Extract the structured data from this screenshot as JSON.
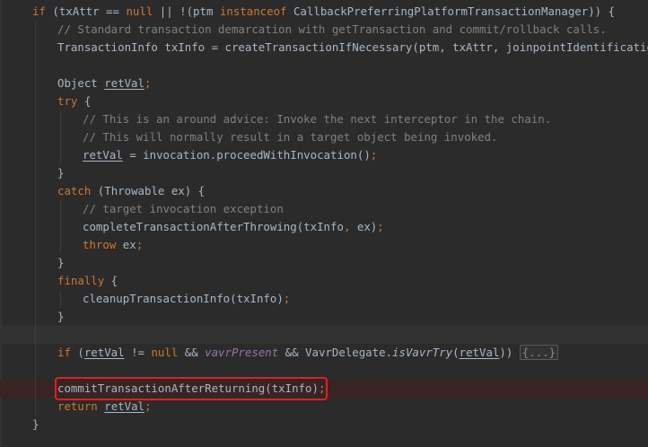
{
  "editor": {
    "colors": {
      "background": "#2b2b2b",
      "default": "#a9b7c6",
      "keyword": "#cc7832",
      "comment": "#808080",
      "field": "#9876aa",
      "highlight_box": "#e0201f"
    },
    "lines": [
      {
        "indent": 1,
        "tokens": [
          {
            "t": "if",
            "c": "kw"
          },
          {
            "t": " (txAttr == "
          },
          {
            "t": "null",
            "c": "kw"
          },
          {
            "t": " || !(ptm "
          },
          {
            "t": "instanceof",
            "c": "kw"
          },
          {
            "t": " CallbackPreferringPlatformTransactionManager)) {"
          }
        ]
      },
      {
        "indent": 2,
        "tokens": [
          {
            "t": "// Standard transaction demarcation with getTransaction and commit/rollback calls.",
            "c": "cm"
          }
        ]
      },
      {
        "indent": 2,
        "tokens": [
          {
            "t": "TransactionInfo txInfo = createTransactionIfNecessary(ptm, txAttr, joinpointIdentification)"
          },
          {
            "t": ";",
            "c": "kw"
          }
        ]
      },
      {
        "indent": 0,
        "tokens": []
      },
      {
        "indent": 2,
        "tokens": [
          {
            "t": "Object "
          },
          {
            "t": "retVal",
            "c": "ul"
          },
          {
            "t": ";",
            "c": "kw"
          }
        ]
      },
      {
        "indent": 2,
        "tokens": [
          {
            "t": "try",
            "c": "kw"
          },
          {
            "t": " {"
          }
        ]
      },
      {
        "indent": 3,
        "tokens": [
          {
            "t": "// This is an around advice: Invoke the next interceptor in the chain.",
            "c": "cm"
          }
        ]
      },
      {
        "indent": 3,
        "tokens": [
          {
            "t": "// This will normally result in a target object being invoked.",
            "c": "cm"
          }
        ]
      },
      {
        "indent": 3,
        "tokens": [
          {
            "t": "retVal",
            "c": "ul"
          },
          {
            "t": " = invocation.proceedWithInvocation()"
          },
          {
            "t": ";",
            "c": "kw"
          }
        ]
      },
      {
        "indent": 2,
        "tokens": [
          {
            "t": "}"
          }
        ]
      },
      {
        "indent": 2,
        "tokens": [
          {
            "t": "catch",
            "c": "kw"
          },
          {
            "t": " (Throwable ex) {"
          }
        ]
      },
      {
        "indent": 3,
        "tokens": [
          {
            "t": "// target invocation exception",
            "c": "cm"
          }
        ]
      },
      {
        "indent": 3,
        "tokens": [
          {
            "t": "completeTransactionAfterThrowing(txInfo"
          },
          {
            "t": ",",
            "c": "kw"
          },
          {
            "t": " ex)"
          },
          {
            "t": ";",
            "c": "kw"
          }
        ]
      },
      {
        "indent": 3,
        "tokens": [
          {
            "t": "throw",
            "c": "kw"
          },
          {
            "t": " ex"
          },
          {
            "t": ";",
            "c": "kw"
          }
        ]
      },
      {
        "indent": 2,
        "tokens": [
          {
            "t": "}"
          }
        ]
      },
      {
        "indent": 2,
        "tokens": [
          {
            "t": "finally",
            "c": "kw"
          },
          {
            "t": " {"
          }
        ]
      },
      {
        "indent": 3,
        "tokens": [
          {
            "t": "cleanupTransactionInfo(txInfo)"
          },
          {
            "t": ";",
            "c": "kw"
          }
        ]
      },
      {
        "indent": 2,
        "tokens": [
          {
            "t": "}"
          }
        ]
      },
      {
        "indent": 0,
        "tokens": [],
        "state": "current"
      },
      {
        "indent": 2,
        "tokens": [
          {
            "t": "if",
            "c": "kw"
          },
          {
            "t": " ("
          },
          {
            "t": "retVal",
            "c": "ul"
          },
          {
            "t": " != "
          },
          {
            "t": "null",
            "c": "kw"
          },
          {
            "t": " && "
          },
          {
            "t": "vavrPresent",
            "c": "fld"
          },
          {
            "t": " && VavrDelegate."
          },
          {
            "t": "isVavrTry",
            "c": "ital"
          },
          {
            "t": "("
          },
          {
            "t": "retVal",
            "c": "ul"
          },
          {
            "t": ")) "
          },
          {
            "t": "{...}",
            "c": "fold"
          }
        ]
      },
      {
        "indent": 0,
        "tokens": []
      },
      {
        "indent": 2,
        "tokens": [
          {
            "t": "commitTransactionAfterReturning(txInfo)"
          },
          {
            "t": ";",
            "c": "kw"
          }
        ],
        "state": "breakpoint",
        "highlighted": true
      },
      {
        "indent": 2,
        "tokens": [
          {
            "t": "return",
            "c": "kw"
          },
          {
            "t": " "
          },
          {
            "t": "retVal",
            "c": "ul"
          },
          {
            "t": ";",
            "c": "kw"
          }
        ]
      },
      {
        "indent": 1,
        "tokens": [
          {
            "t": "}"
          }
        ]
      }
    ]
  }
}
